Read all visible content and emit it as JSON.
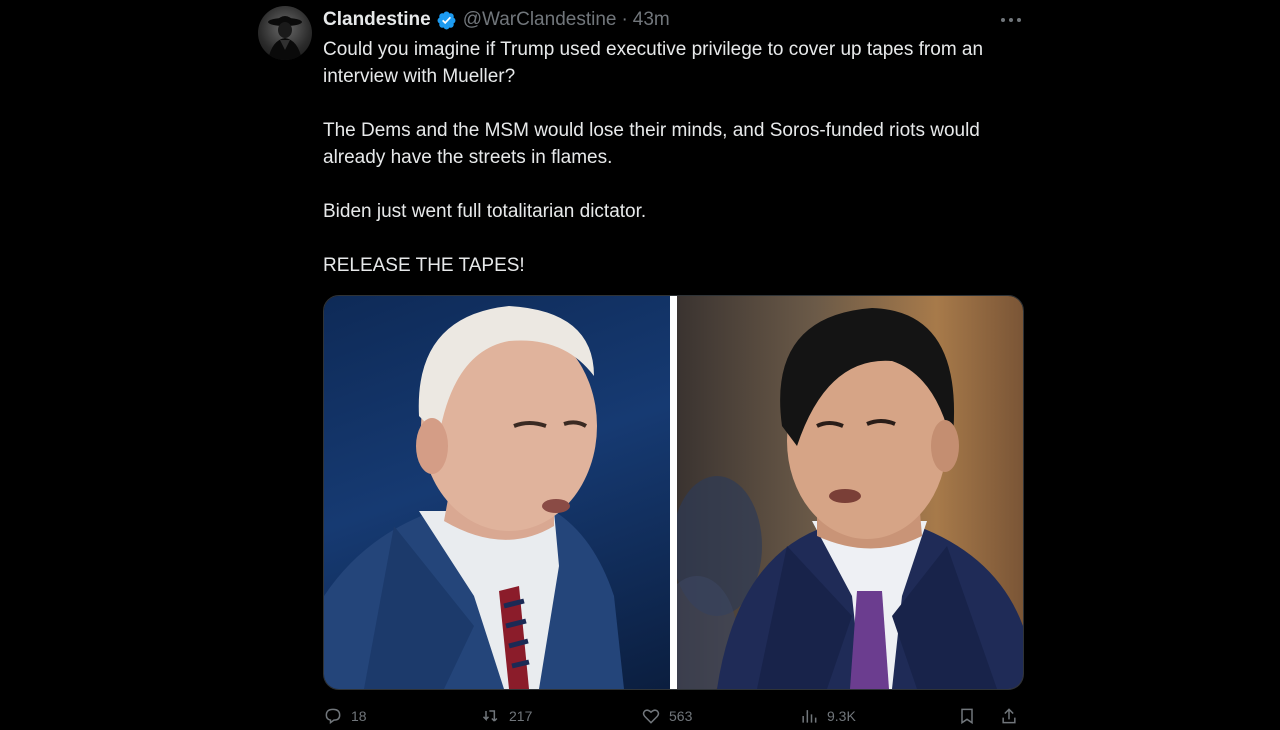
{
  "tweet": {
    "display_name": "Clandestine",
    "handle": "@WarClandestine",
    "separator": "·",
    "time": "43m",
    "paragraphs": [
      "Could you imagine if Trump used executive privilege to cover up tapes from an interview with Mueller?",
      "The Dems and the MSM would lose their minds, and Soros-funded riots would already have the streets in flames.",
      "Biden just went full totalitarian dictator.",
      "RELEASE THE TAPES!"
    ],
    "actions": {
      "replies": "18",
      "reposts": "217",
      "likes": "563",
      "views": "9.3K"
    }
  },
  "colors": {
    "background": "#000000",
    "text": "#e7e9ea",
    "muted": "#71767b",
    "verified": "#1d9bf0"
  },
  "icons": [
    "verified-badge-icon",
    "more-options-icon",
    "reply-icon",
    "repost-icon",
    "like-icon",
    "views-icon",
    "bookmark-icon",
    "share-icon"
  ]
}
